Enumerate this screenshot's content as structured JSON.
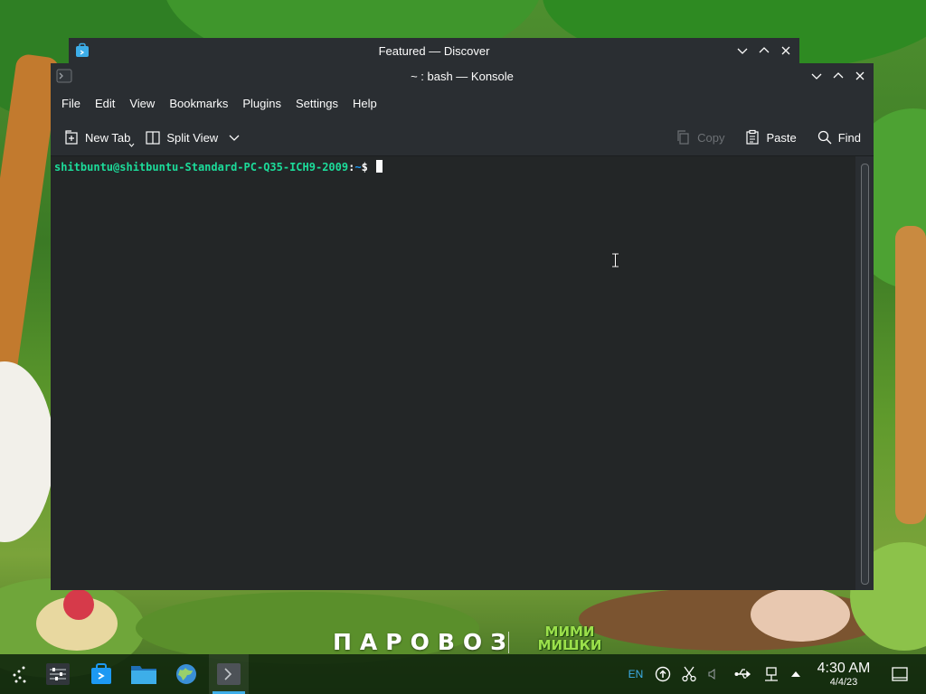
{
  "background_window": {
    "title": "Featured — Discover"
  },
  "konsole": {
    "title": "~ : bash — Konsole",
    "menu": [
      "File",
      "Edit",
      "View",
      "Bookmarks",
      "Plugins",
      "Settings",
      "Help"
    ],
    "toolbar": {
      "new_tab": "New Tab",
      "split_view": "Split View",
      "copy": "Copy",
      "paste": "Paste",
      "find": "Find"
    },
    "prompt": {
      "user_host": "shitbuntu@shitbuntu-Standard-PC-Q35-ICH9-2009",
      "separator": ":",
      "path": "~",
      "symbol": "$"
    }
  },
  "wallpaper": {
    "logo_left": "ПАРОВОЗ",
    "logo_right_top": "МИМИ",
    "logo_right_bottom": "МИШКИ"
  },
  "taskbar": {
    "tray": {
      "keyboard_layout": "EN"
    },
    "clock": {
      "time": "4:30 AM",
      "date": "4/4/23"
    }
  },
  "colors": {
    "prompt_user": "#1cdc9a",
    "prompt_path": "#1d99f3",
    "accent": "#3daee9",
    "window_bg": "#2a2e32"
  }
}
